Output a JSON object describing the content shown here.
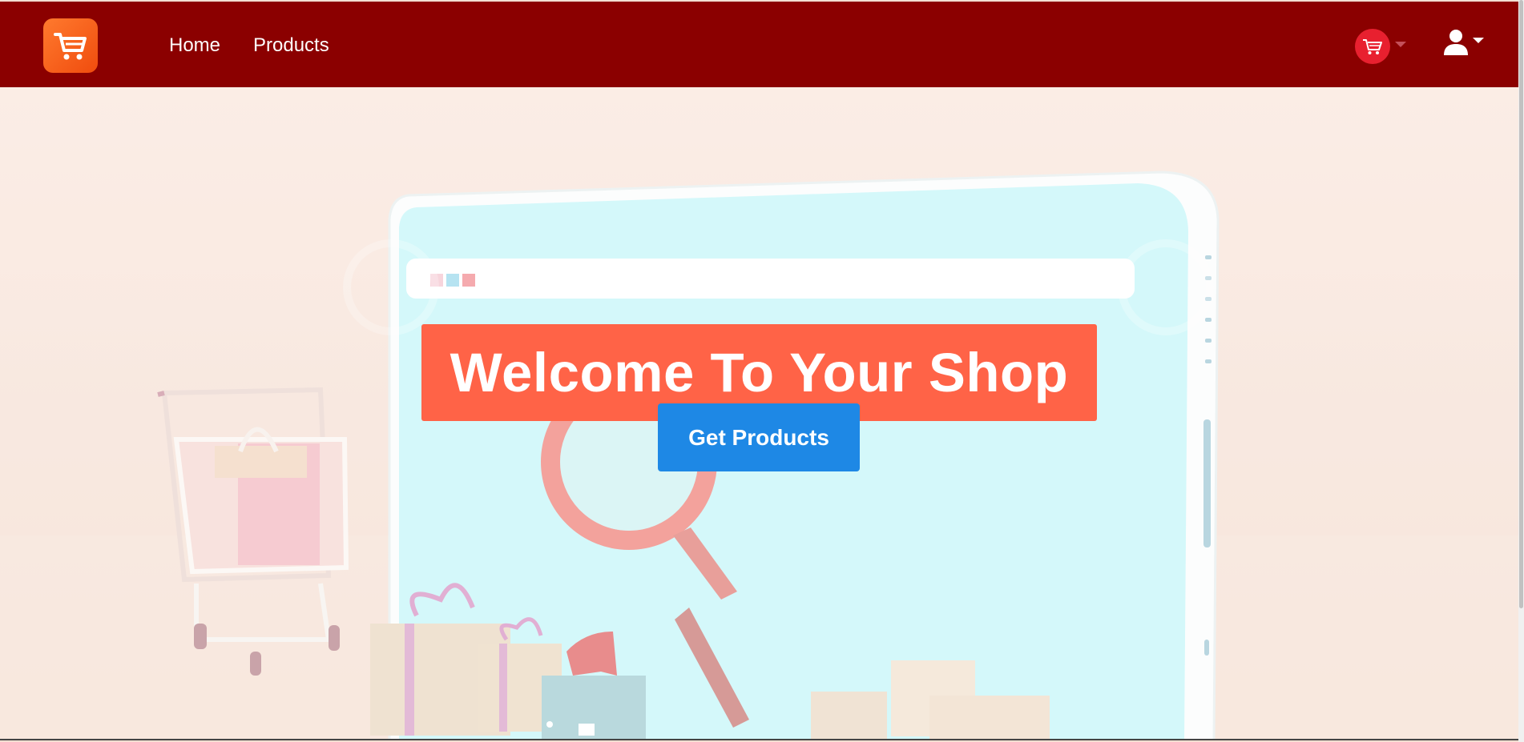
{
  "navbar": {
    "brand_icon": "shopping-cart-icon",
    "links": [
      {
        "label": "Home"
      },
      {
        "label": "Products"
      }
    ],
    "cart_icon": "shopping-cart-icon",
    "user_icon": "user-icon",
    "background_color": "#8b0000"
  },
  "hero": {
    "headline": "Welcome To Your Shop",
    "cta_label": "Get Products",
    "headline_color": "#ff6347",
    "cta_color": "#1e88e5"
  }
}
